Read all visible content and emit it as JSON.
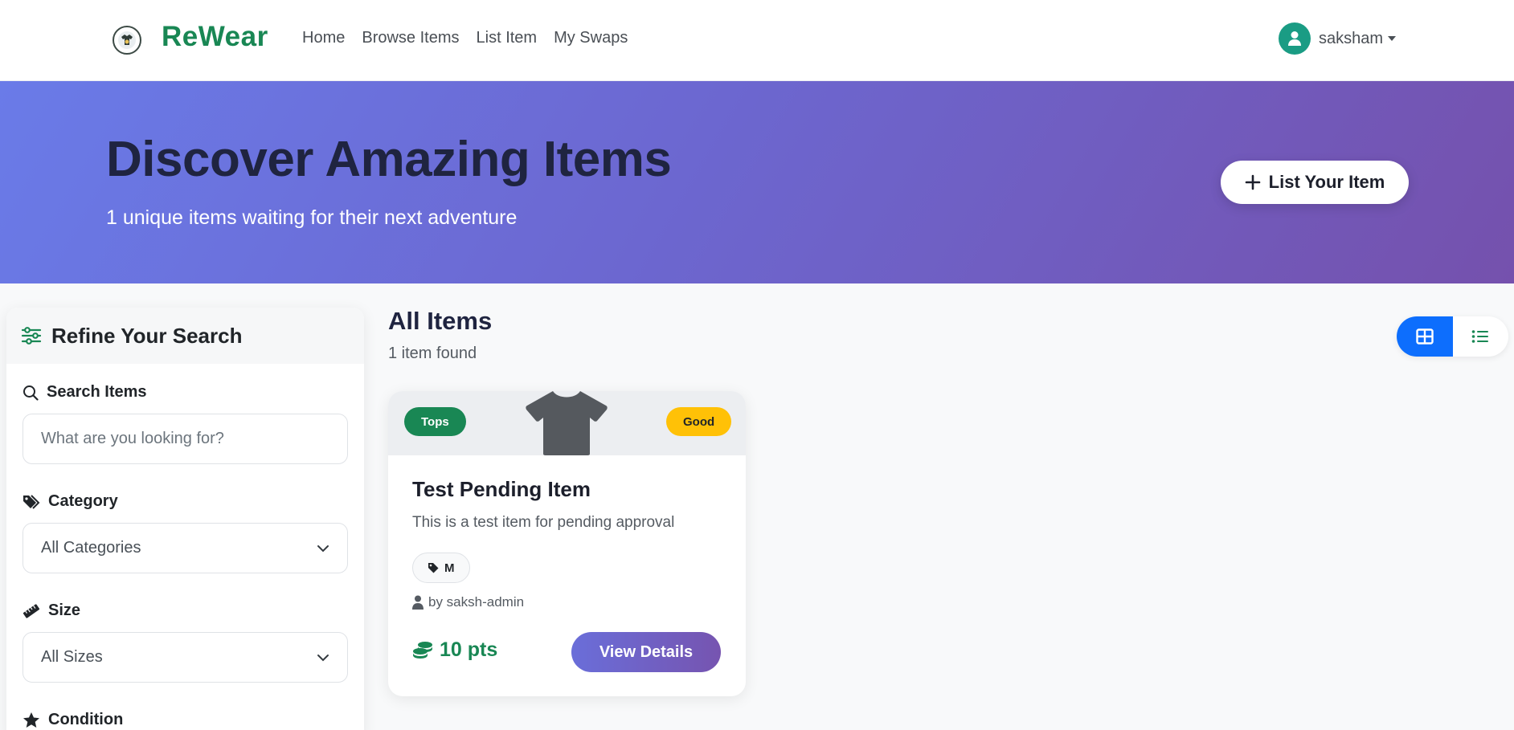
{
  "navbar": {
    "brand": "ReWear",
    "links": [
      "Home",
      "Browse Items",
      "List Item",
      "My Swaps"
    ],
    "user": "saksham"
  },
  "hero": {
    "title": "Discover Amazing Items",
    "subtitle": "1 unique items waiting for their next adventure",
    "button_label": "List Your Item"
  },
  "sidebar": {
    "title": "Refine Your Search",
    "search": {
      "label": "Search Items",
      "placeholder": "What are you looking for?"
    },
    "category": {
      "label": "Category",
      "selected": "All Categories"
    },
    "size": {
      "label": "Size",
      "selected": "All Sizes"
    },
    "condition": {
      "label": "Condition"
    }
  },
  "main": {
    "title": "All Items",
    "count": "1 item found"
  },
  "items": [
    {
      "category": "Tops",
      "condition": "Good",
      "title": "Test Pending Item",
      "description": "This is a test item for pending approval",
      "size": "M",
      "owner": "by saksh-admin",
      "points": "10 pts",
      "button": "View Details"
    }
  ],
  "colors": {
    "brand_green": "#198754",
    "hero_gradient_start": "#6a7be8",
    "hero_gradient_end": "#7551ad",
    "toggle_active": "#0d6efd",
    "condition_badge": "#ffc107"
  },
  "icons": {
    "brand": "brand-logo-icon",
    "user": "user-avatar-icon",
    "add": "plus-icon",
    "filters": "sliders-icon",
    "search": "search-icon",
    "category": "tags-icon",
    "size": "ruler-icon",
    "condition": "star-icon",
    "grid": "grid-view-icon",
    "list": "list-view-icon",
    "item_image": "tshirt-icon",
    "size_tag": "tag-icon",
    "owner": "person-icon",
    "points": "coins-icon"
  }
}
